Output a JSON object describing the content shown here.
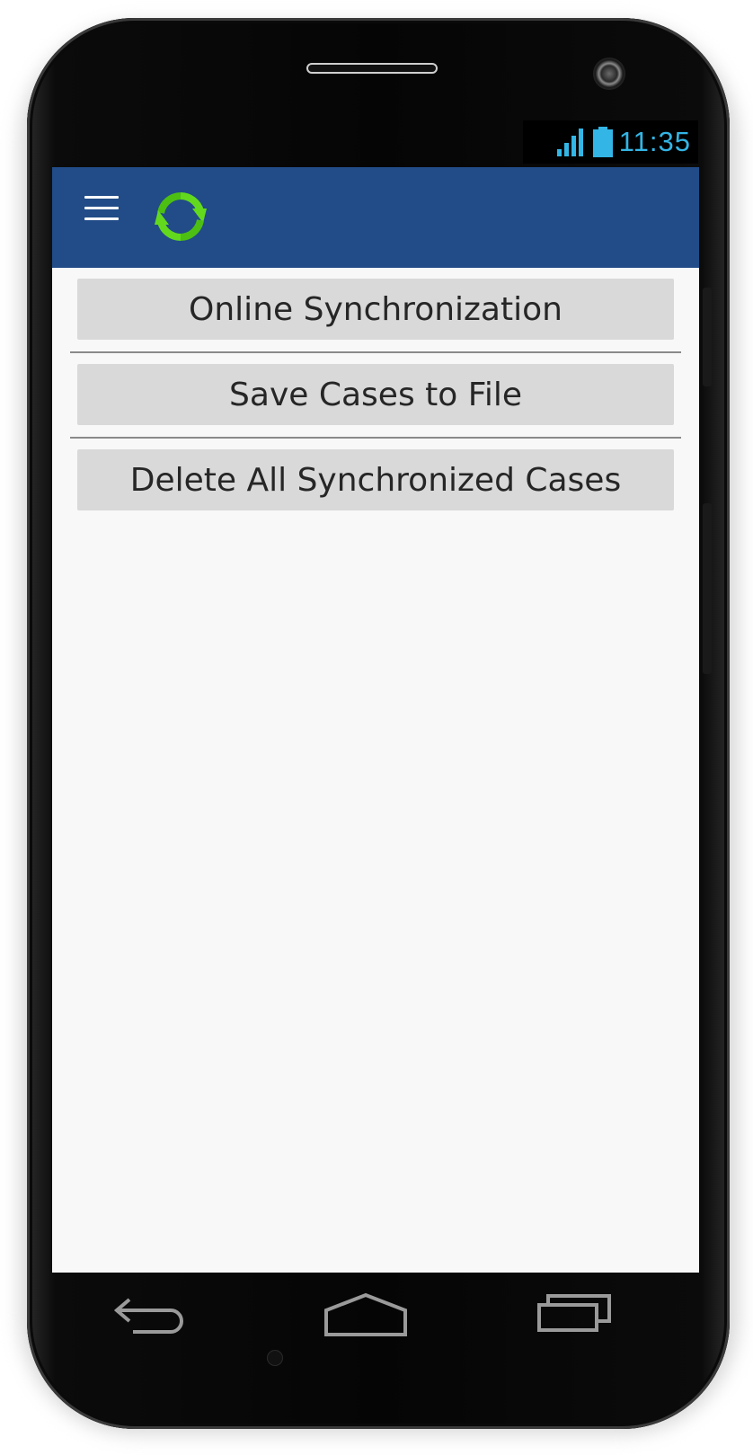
{
  "status_bar": {
    "time": "11:35",
    "accent_color": "#33b5e5",
    "signal_icon": "signal-icon",
    "battery_icon": "battery-icon"
  },
  "app_bar": {
    "background_color": "#214c87",
    "menu_icon": "hamburger-menu-icon",
    "logo_icon": "sync-arrows-icon"
  },
  "actions": [
    {
      "label": "Online Synchronization"
    },
    {
      "label": "Save Cases to File"
    },
    {
      "label": "Delete All Synchronized Cases"
    }
  ],
  "nav_bar": {
    "back_icon": "back-icon",
    "home_icon": "home-icon",
    "recents_icon": "recent-apps-icon"
  }
}
